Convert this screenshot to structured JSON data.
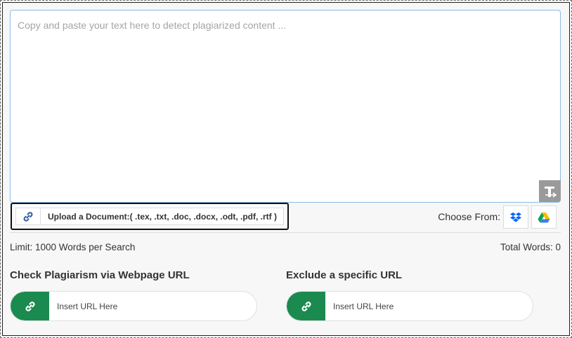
{
  "editor": {
    "placeholder": "Copy and paste your text here to detect plagiarized content ..."
  },
  "icons": {
    "format": "text-format-icon",
    "upload": "link-icon",
    "dropbox": "dropbox-icon",
    "gdrive": "google-drive-icon"
  },
  "upload": {
    "label": "Upload a Document:( .tex, .txt, .doc, .docx, .odt, .pdf, .rtf )"
  },
  "choose_from": {
    "label": "Choose From:"
  },
  "stats": {
    "limit": "Limit: 1000 Words per Search",
    "total_words": "Total Words: 0"
  },
  "webpage_url": {
    "title": "Check Plagiarism via Webpage URL",
    "placeholder": "Insert URL Here"
  },
  "exclude_url": {
    "title": "Exclude a specific URL",
    "placeholder": "Insert URL Here"
  },
  "colors": {
    "accent_green": "#1a8a4f",
    "dropbox_blue": "#0061fe",
    "focus_border": "#8bbbe6"
  }
}
